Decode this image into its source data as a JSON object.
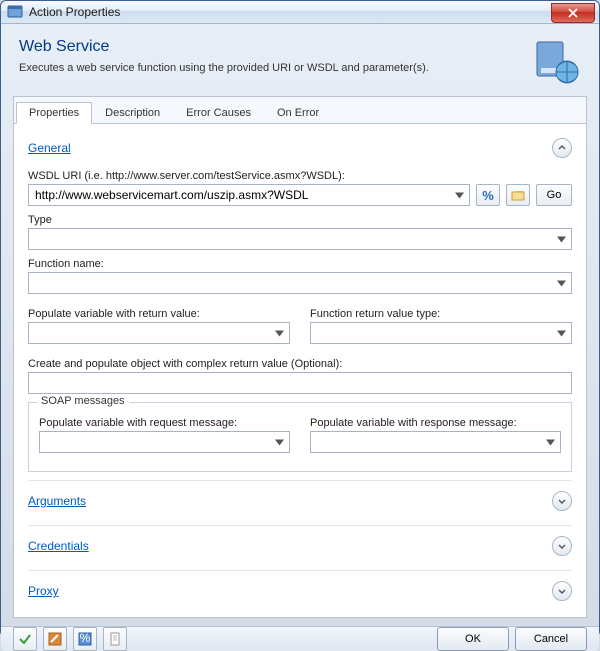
{
  "window": {
    "title": "Action Properties"
  },
  "header": {
    "title": "Web Service",
    "description": "Executes a web service function using the provided URI or WSDL and parameter(s)."
  },
  "tabs": [
    {
      "label": "Properties",
      "active": true
    },
    {
      "label": "Description",
      "active": false
    },
    {
      "label": "Error Causes",
      "active": false
    },
    {
      "label": "On Error",
      "active": false
    }
  ],
  "sections": {
    "general": {
      "title": "General",
      "wsdl_label": "WSDL URI (i.e. http://www.server.com/testService.asmx?WSDL):",
      "wsdl_value": "http://www.webservicemart.com/uszip.asmx?WSDL",
      "go_label": "Go",
      "type_label": "Type",
      "type_value": "",
      "function_label": "Function name:",
      "function_value": "",
      "populate_return_label": "Populate variable with return value:",
      "populate_return_value": "",
      "return_type_label": "Function return value type:",
      "return_type_value": "",
      "complex_label": "Create and populate object with complex return value (Optional):",
      "complex_value": "",
      "soap_legend": "SOAP messages",
      "soap_req_label": "Populate variable with request message:",
      "soap_req_value": "",
      "soap_resp_label": "Populate variable with response message:",
      "soap_resp_value": ""
    },
    "arguments": {
      "title": "Arguments"
    },
    "credentials": {
      "title": "Credentials"
    },
    "proxy": {
      "title": "Proxy"
    }
  },
  "buttons": {
    "ok": "OK",
    "cancel": "Cancel"
  }
}
